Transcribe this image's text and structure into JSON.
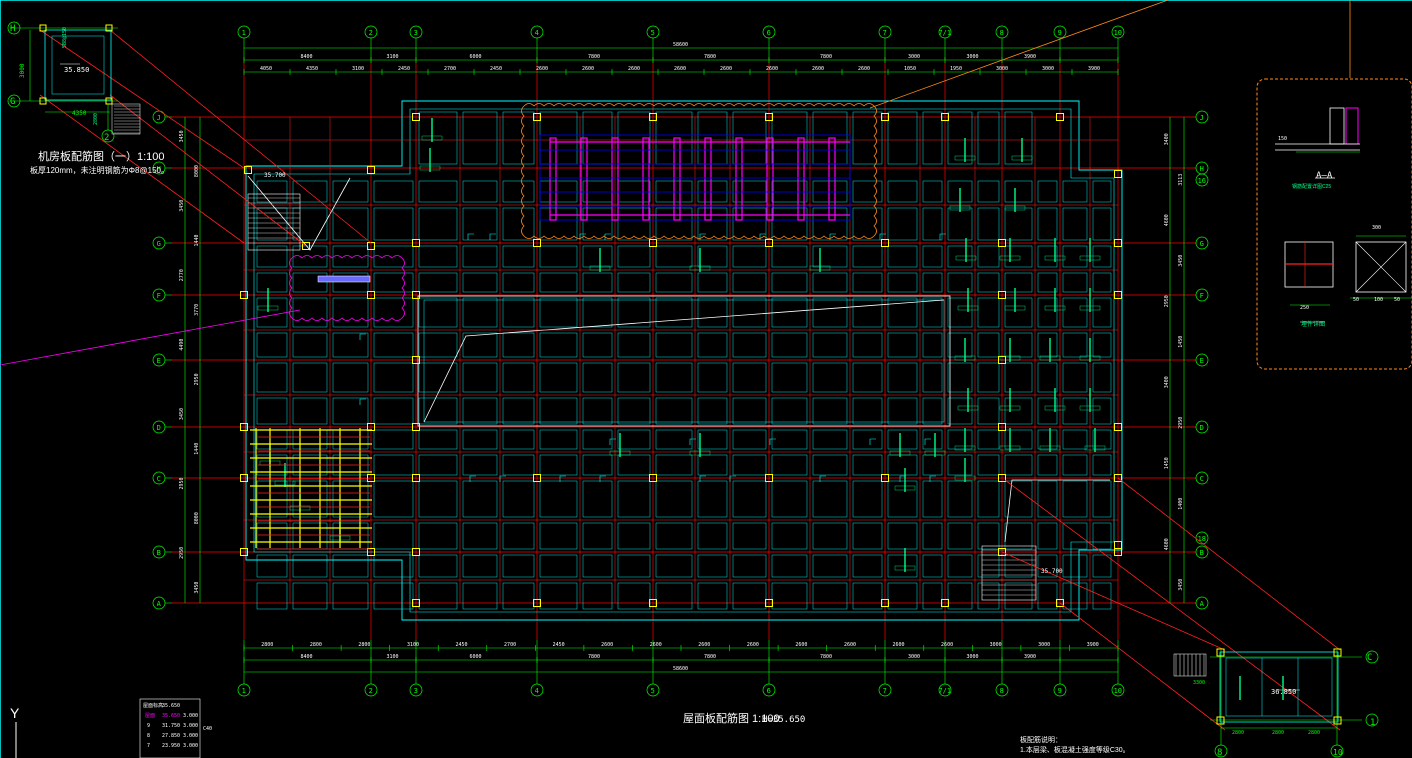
{
  "colors": {
    "background": "#000000",
    "grid": "#00ff00",
    "axis": "#ff0000",
    "wall": "#00ffff",
    "beam": "#ff2020",
    "column": "#ffff00",
    "rebar": "#ff00ff",
    "revision": "#ff8c1a",
    "text": "#ffffff",
    "label": "#00ff88",
    "yellow": "#ffff00"
  },
  "axes": {
    "columns": [
      "1",
      "2",
      "3",
      "4",
      "5",
      "6",
      "7",
      "7/1",
      "8",
      "9",
      "10"
    ],
    "rows": [
      "J",
      "H",
      "G",
      "F",
      "E",
      "D",
      "C",
      "B",
      "A"
    ],
    "right_extra": [
      "16",
      "18"
    ]
  },
  "dimensions": {
    "top_total": "58600",
    "top_row1": [
      "8400",
      "3100",
      "6000",
      "7800",
      "7800",
      "7800",
      "3000",
      "3000",
      "3900"
    ],
    "top_row2": [
      "4050",
      "4350",
      "3100",
      "2450",
      "2700",
      "2450",
      "2600",
      "2600",
      "2600",
      "2600",
      "2600",
      "2600",
      "2600",
      "2600",
      "1050",
      "1950",
      "3000",
      "3000",
      "3900"
    ],
    "bottom_row1": [
      "2800",
      "2800",
      "2800",
      "3100",
      "2450",
      "2700",
      "2450",
      "2600",
      "2600",
      "2600",
      "2600",
      "2600",
      "2600",
      "2600",
      "2600",
      "3000",
      "3000",
      "3900"
    ],
    "bottom_row2": [
      "8400",
      "3100",
      "6000",
      "7800",
      "7800",
      "7800",
      "3000",
      "3000",
      "3900"
    ],
    "bottom_total": "58600",
    "left": [
      "3450",
      "8000",
      "3450",
      "1440",
      "2770",
      "3770",
      "4490",
      "2950",
      "3450",
      "1440",
      "2950",
      "8000",
      "2950",
      "3450"
    ],
    "right": [
      "3400",
      "3113",
      "4600",
      "3450",
      "2950",
      "1450",
      "3400",
      "2950",
      "1450",
      "1400",
      "4600",
      "3450"
    ]
  },
  "titles": {
    "main_title": "屋面板配筋图 1:100",
    "main_elev": "H=35.650",
    "machine_title": "机房板配筋图（一）1:100",
    "machine_note": "板厚120mm，未注明钢筋为Φ8@150。",
    "section_title": "A—A",
    "section_note": "钢筋配置详图C25",
    "detail_title": "埋件详图",
    "notes_title": "板配筋说明：",
    "notes_line1": "1.本层梁、板混凝土强度等级C30。"
  },
  "labels": {
    "machine_axis_h": "H",
    "machine_axis_g": "G",
    "machine_axis_2": "2",
    "machine_dim_3": "3000",
    "machine_dim_4": "4350",
    "machine_elev": "35.850",
    "machine_rebar": "5B8@150",
    "machine_dim_v": "2800",
    "plan_elev_l": "35.700",
    "plan_elev_r": "35.700",
    "bl_axis_c": "C",
    "bl_axis_1": "1",
    "bl_axis_8": "8",
    "bl_axis_10": "10",
    "bl_elev": "36.850",
    "bl_dim1": "2800",
    "bl_dim2": "2800",
    "bl_dim3": "2800",
    "bl_dim_side": "3300",
    "det_dim_300": "300",
    "det_dim_250": "250",
    "det_dim_50a": "50",
    "det_dim_50b": "50",
    "det_dim_100": "100",
    "det_dim_150": "150"
  },
  "elevation_table": {
    "header": [
      "屋面标高",
      "35.650",
      ""
    ],
    "rows": [
      [
        "屋面",
        "35.650",
        "3.000"
      ],
      [
        "9",
        "31.750",
        "3.000"
      ],
      [
        "8",
        "27.850",
        "3.000"
      ],
      [
        "7",
        "23.950",
        "3.000"
      ]
    ],
    "side_label": "C40"
  },
  "ucs": "Y"
}
